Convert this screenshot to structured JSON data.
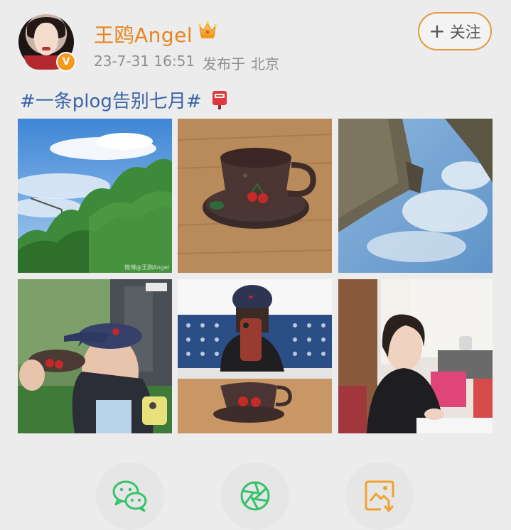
{
  "author": {
    "name": "王鸥Angel",
    "time": "23-7-31 16:51",
    "published_at_label": "发布于",
    "location": "北京",
    "verified_badge": "V"
  },
  "follow_button": {
    "plus": "+",
    "label": "关注"
  },
  "post": {
    "text": "#一条plog告别七月#"
  },
  "photos": [
    {
      "subject": "sky-and-trees",
      "watermark": "微博@王鸥Angel"
    },
    {
      "subject": "ceramic-cup"
    },
    {
      "subject": "sky-reflection"
    },
    {
      "subject": "selfie-with-cup"
    },
    {
      "subject": "mirror-selfie"
    },
    {
      "subject": "woman-at-desk"
    }
  ],
  "share_options": [
    {
      "icon": "wechat-icon",
      "color": "#35c26b"
    },
    {
      "icon": "moments-icon",
      "color": "#35c26b"
    },
    {
      "icon": "save-image-icon",
      "color": "#f0a32c"
    }
  ],
  "colors": {
    "username": "#e8841c",
    "hashtag": "#3b63a7",
    "follow_border": "#e39a3c",
    "background": "#ececec"
  }
}
